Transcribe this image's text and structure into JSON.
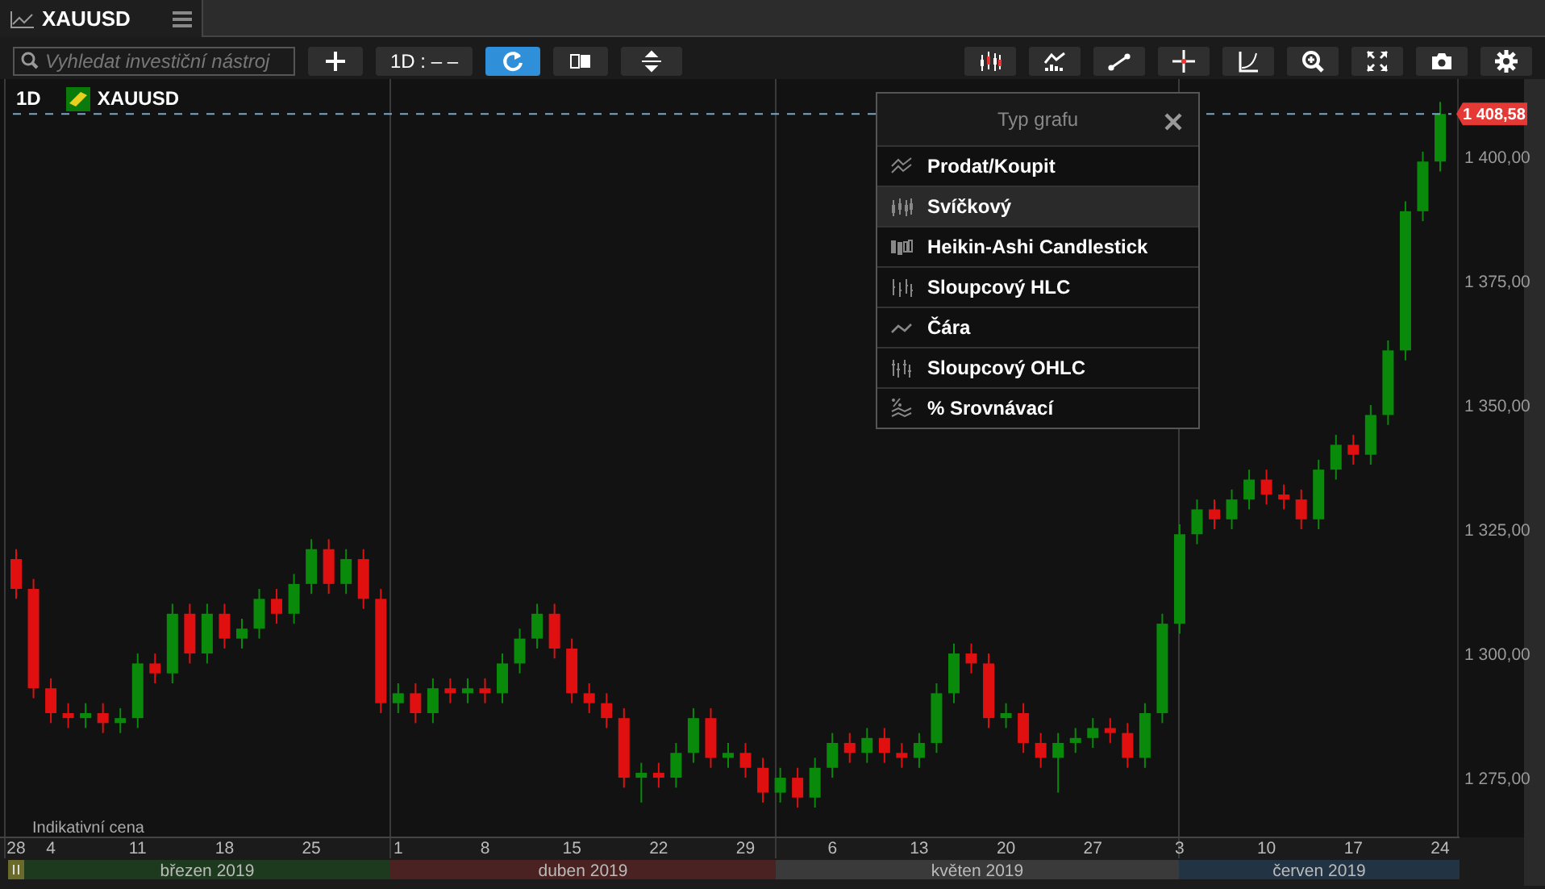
{
  "tab": {
    "title": "XAUUSD"
  },
  "toolbar": {
    "search": {
      "placeholder": "Vyhledat investiční nástroj"
    },
    "left_buttons": [
      {
        "kind": "plus",
        "active": false
      },
      {
        "kind": "timeframe",
        "label": "1D : – –",
        "active": false
      },
      {
        "kind": "refresh",
        "active": true
      },
      {
        "kind": "layout",
        "active": false
      },
      {
        "kind": "split",
        "active": false
      }
    ],
    "right_buttons": [
      {
        "kind": "candles"
      },
      {
        "kind": "indicators"
      },
      {
        "kind": "line"
      },
      {
        "kind": "crosshair"
      },
      {
        "kind": "curve"
      },
      {
        "kind": "zoom"
      },
      {
        "kind": "fullscreen"
      },
      {
        "kind": "camera"
      },
      {
        "kind": "settings"
      }
    ]
  },
  "chart": {
    "timeframe": "1D",
    "symbol": "XAUUSD",
    "last_price": "1 408,58",
    "note": "Indikativní cena",
    "chart_data": {
      "type": "candlestick",
      "categories": [
        "28",
        null,
        "4",
        null,
        null,
        null,
        null,
        "11",
        null,
        null,
        null,
        null,
        "18",
        null,
        null,
        null,
        null,
        "25",
        null,
        null,
        null,
        null,
        "1",
        null,
        null,
        null,
        null,
        "8",
        null,
        null,
        null,
        null,
        "15",
        null,
        null,
        null,
        null,
        "22",
        null,
        null,
        null,
        null,
        "29",
        null,
        null,
        null,
        null,
        "6",
        null,
        null,
        null,
        null,
        "13",
        null,
        null,
        null,
        null,
        "20",
        null,
        null,
        null,
        null,
        "27",
        null,
        null,
        null,
        null,
        "3",
        null,
        null,
        null,
        null,
        "10",
        null,
        null,
        null,
        null,
        "17",
        null,
        null,
        null,
        null,
        "24"
      ],
      "ylim": [
        1263,
        1415.6
      ],
      "ref_lines": [
        {
          "axis": "y",
          "value": 1408.58
        }
      ],
      "ohlc": [
        [
          1319,
          1321,
          1311,
          1313
        ],
        [
          1313,
          1315,
          1291,
          1293
        ],
        [
          1293,
          1295,
          1286,
          1288
        ],
        [
          1288,
          1290,
          1285,
          1287
        ],
        [
          1287,
          1290,
          1285,
          1288
        ],
        [
          1288,
          1290,
          1284,
          1286
        ],
        [
          1286,
          1289,
          1284,
          1287
        ],
        [
          1287,
          1300,
          1285,
          1298
        ],
        [
          1298,
          1300,
          1294,
          1296
        ],
        [
          1296,
          1310,
          1294,
          1308
        ],
        [
          1308,
          1310,
          1298,
          1300
        ],
        [
          1300,
          1310,
          1298,
          1308
        ],
        [
          1308,
          1310,
          1301,
          1303
        ],
        [
          1303,
          1307,
          1301,
          1305
        ],
        [
          1305,
          1313,
          1303,
          1311
        ],
        [
          1311,
          1313,
          1306,
          1308
        ],
        [
          1308,
          1316,
          1306,
          1314
        ],
        [
          1314,
          1323,
          1312,
          1321
        ],
        [
          1321,
          1323,
          1312,
          1314
        ],
        [
          1314,
          1321,
          1312,
          1319
        ],
        [
          1319,
          1321,
          1309,
          1311
        ],
        [
          1311,
          1313,
          1288,
          1290
        ],
        [
          1290,
          1294,
          1288,
          1292
        ],
        [
          1292,
          1294,
          1286,
          1288
        ],
        [
          1288,
          1295,
          1286,
          1293
        ],
        [
          1293,
          1295,
          1290,
          1292
        ],
        [
          1292,
          1295,
          1290,
          1293
        ],
        [
          1293,
          1295,
          1290,
          1292
        ],
        [
          1292,
          1300,
          1290,
          1298
        ],
        [
          1298,
          1305,
          1296,
          1303
        ],
        [
          1303,
          1310,
          1301,
          1308
        ],
        [
          1308,
          1310,
          1299,
          1301
        ],
        [
          1301,
          1303,
          1290,
          1292
        ],
        [
          1292,
          1294,
          1288,
          1290
        ],
        [
          1290,
          1292,
          1285,
          1287
        ],
        [
          1287,
          1289,
          1273,
          1275
        ],
        [
          1275,
          1278,
          1270,
          1276
        ],
        [
          1276,
          1278,
          1273,
          1275
        ],
        [
          1275,
          1282,
          1273,
          1280
        ],
        [
          1280,
          1289,
          1278,
          1287
        ],
        [
          1287,
          1289,
          1277,
          1279
        ],
        [
          1279,
          1282,
          1277,
          1280
        ],
        [
          1280,
          1282,
          1275,
          1277
        ],
        [
          1277,
          1279,
          1270,
          1272
        ],
        [
          1272,
          1277,
          1270,
          1275
        ],
        [
          1275,
          1277,
          1269,
          1271
        ],
        [
          1271,
          1279,
          1269,
          1277
        ],
        [
          1277,
          1284,
          1275,
          1282
        ],
        [
          1282,
          1284,
          1278,
          1280
        ],
        [
          1280,
          1285,
          1278,
          1283
        ],
        [
          1283,
          1285,
          1278,
          1280
        ],
        [
          1280,
          1282,
          1277,
          1279
        ],
        [
          1279,
          1284,
          1277,
          1282
        ],
        [
          1282,
          1294,
          1280,
          1292
        ],
        [
          1292,
          1302,
          1290,
          1300
        ],
        [
          1300,
          1302,
          1296,
          1298
        ],
        [
          1298,
          1300,
          1285,
          1287
        ],
        [
          1287,
          1290,
          1285,
          1288
        ],
        [
          1288,
          1290,
          1280,
          1282
        ],
        [
          1282,
          1284,
          1277,
          1279
        ],
        [
          1279,
          1284,
          1272,
          1282
        ],
        [
          1282,
          1285,
          1280,
          1283
        ],
        [
          1283,
          1287,
          1281,
          1285
        ],
        [
          1285,
          1287,
          1282,
          1284
        ],
        [
          1284,
          1286,
          1277,
          1279
        ],
        [
          1279,
          1290,
          1277,
          1288
        ],
        [
          1288,
          1308,
          1286,
          1306
        ],
        [
          1306,
          1326,
          1304,
          1324
        ],
        [
          1324,
          1331,
          1322,
          1329
        ],
        [
          1329,
          1331,
          1325,
          1327
        ],
        [
          1327,
          1333,
          1325,
          1331
        ],
        [
          1331,
          1337,
          1329,
          1335
        ],
        [
          1335,
          1337,
          1330,
          1332
        ],
        [
          1332,
          1334,
          1329,
          1331
        ],
        [
          1331,
          1333,
          1325,
          1327
        ],
        [
          1327,
          1339,
          1325,
          1337
        ],
        [
          1337,
          1344,
          1335,
          1342
        ],
        [
          1342,
          1344,
          1338,
          1340
        ],
        [
          1340,
          1350,
          1338,
          1348
        ],
        [
          1348,
          1363,
          1346,
          1361
        ],
        [
          1361,
          1391,
          1359,
          1389
        ],
        [
          1389,
          1401,
          1387,
          1399
        ],
        [
          1399,
          1411,
          1397,
          1408.58
        ]
      ],
      "yticks": [
        {
          "value": 1400,
          "label": "1 400,00"
        },
        {
          "value": 1375,
          "label": "1 375,00"
        },
        {
          "value": 1350,
          "label": "1 350,00"
        },
        {
          "value": 1325,
          "label": "1 325,00"
        },
        {
          "value": 1300,
          "label": "1 300,00"
        },
        {
          "value": 1275,
          "label": "1 275,00"
        }
      ]
    },
    "months": [
      {
        "label": "březen 2019",
        "color": "#1e3a1e"
      },
      {
        "label": "duben 2019",
        "color": "#4a2222"
      },
      {
        "label": "květen 2019",
        "color": "#3a3a3a"
      },
      {
        "label": "červen 2019",
        "color": "#223344"
      }
    ]
  },
  "dialog": {
    "title": "Typ grafu",
    "items": [
      {
        "kind": "bidask",
        "label": "Prodat/Koupit",
        "selected": false
      },
      {
        "kind": "candle",
        "label": "Svíčkový",
        "selected": true
      },
      {
        "kind": "heikin",
        "label": "Heikin-Ashi Candlestick",
        "selected": false
      },
      {
        "kind": "hlc",
        "label": "Sloupcový HLC",
        "selected": false
      },
      {
        "kind": "line",
        "label": "Čára",
        "selected": false
      },
      {
        "kind": "ohlc",
        "label": "Sloupcový OHLC",
        "selected": false
      },
      {
        "kind": "percent",
        "label": "% Srovnávací",
        "selected": false
      }
    ]
  }
}
